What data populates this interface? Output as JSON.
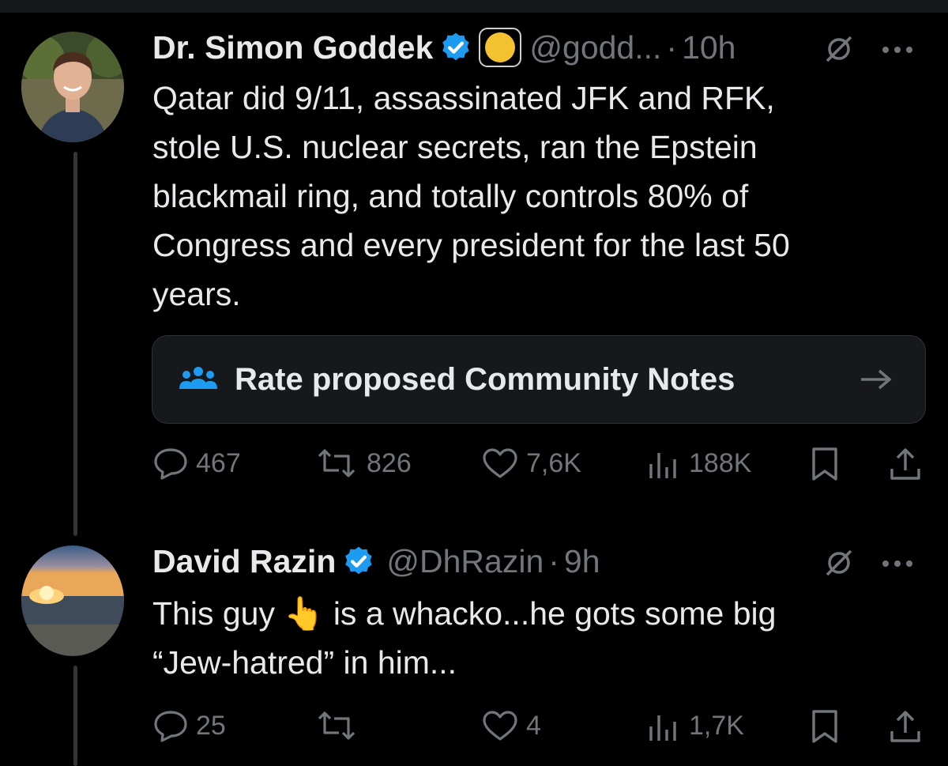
{
  "tweet1": {
    "name": "Dr. Simon Goddek",
    "handle": "@godd...",
    "dot": "·",
    "time": "10h",
    "lines": [
      "Qatar did 9/11, assassinated JFK and RFK,",
      "stole U.S. nuclear secrets, ran the Epstein",
      "blackmail ring, and totally controls 80% of",
      "Congress and every president for the last 50",
      "years."
    ],
    "community_notes_label": "Rate proposed Community Notes",
    "arrow": "→",
    "replies": "467",
    "reposts": "826",
    "likes": "7,6K",
    "views": "188K"
  },
  "tweet2": {
    "name": "David Razin",
    "handle": "@DhRazin",
    "dot": "·",
    "time": "9h",
    "line1_a": "This guy",
    "emoji": "👆",
    "line1_b": "is a whacko...he gots some big",
    "line2": "“Jew-hatred” in him...",
    "replies": "25",
    "reposts": "",
    "likes": "4",
    "views": "1,7K"
  },
  "colors": {
    "background": "#000000",
    "text": "#e7e9ea",
    "muted": "#71767b",
    "verified": "#1d9bf0",
    "notes_icon": "#1d9bf0",
    "gold_badge": "#f2c230"
  },
  "icons": [
    "verified-badge-icon",
    "gold-circle-icon",
    "grok-icon",
    "more-icon",
    "community-notes-icon",
    "arrow-right-icon",
    "reply-icon",
    "repost-icon",
    "like-icon",
    "views-icon",
    "bookmark-icon",
    "share-icon"
  ]
}
